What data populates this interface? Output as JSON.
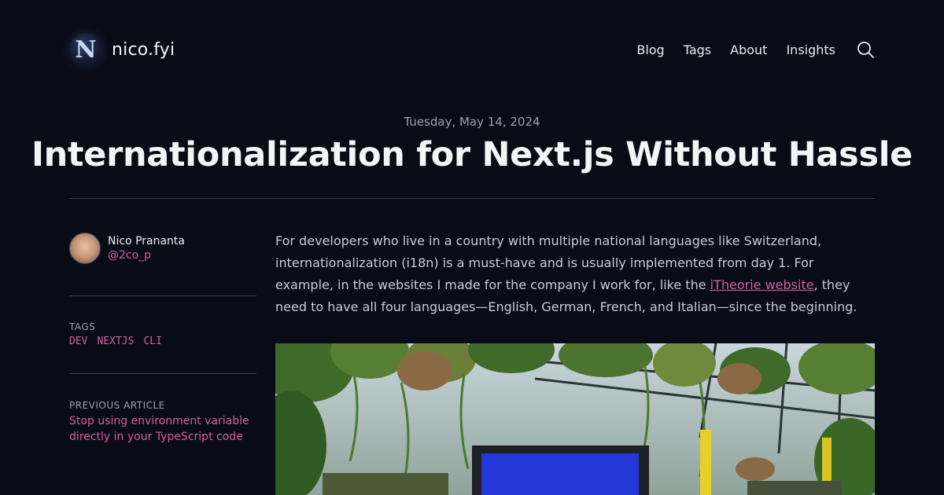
{
  "header": {
    "site_name": "nico.fyi",
    "logo_letter": "N",
    "nav": [
      "Blog",
      "Tags",
      "About",
      "Insights"
    ],
    "search_icon": "search-icon"
  },
  "post": {
    "date": "Tuesday, May 14, 2024",
    "title": "Internationalization for Next.js Without Hassle"
  },
  "sidebar": {
    "author_name": "Nico Prananta",
    "author_handle": "@2co_p",
    "tags_label": "TAGS",
    "tags": [
      "DEV",
      "NEXTJS",
      "CLI"
    ],
    "prev_label": "PREVIOUS ARTICLE",
    "prev_title_line1": "Stop using environment variable",
    "prev_title_line2": "directly in your TypeScript code"
  },
  "content": {
    "intro_before_link": "For developers who live in a country with multiple national languages like Switzerland, internationalization (i18n) is a must-have and is usually implemented from day 1. For example, in the websites I made for the company I work for, like the ",
    "intro_link": "iTheorie website",
    "intro_after_link": ", they need to have all four languages—English, German, French, and Italian—since the beginning."
  },
  "colors": {
    "background": "#090c16",
    "accent": "#d35fa0"
  }
}
